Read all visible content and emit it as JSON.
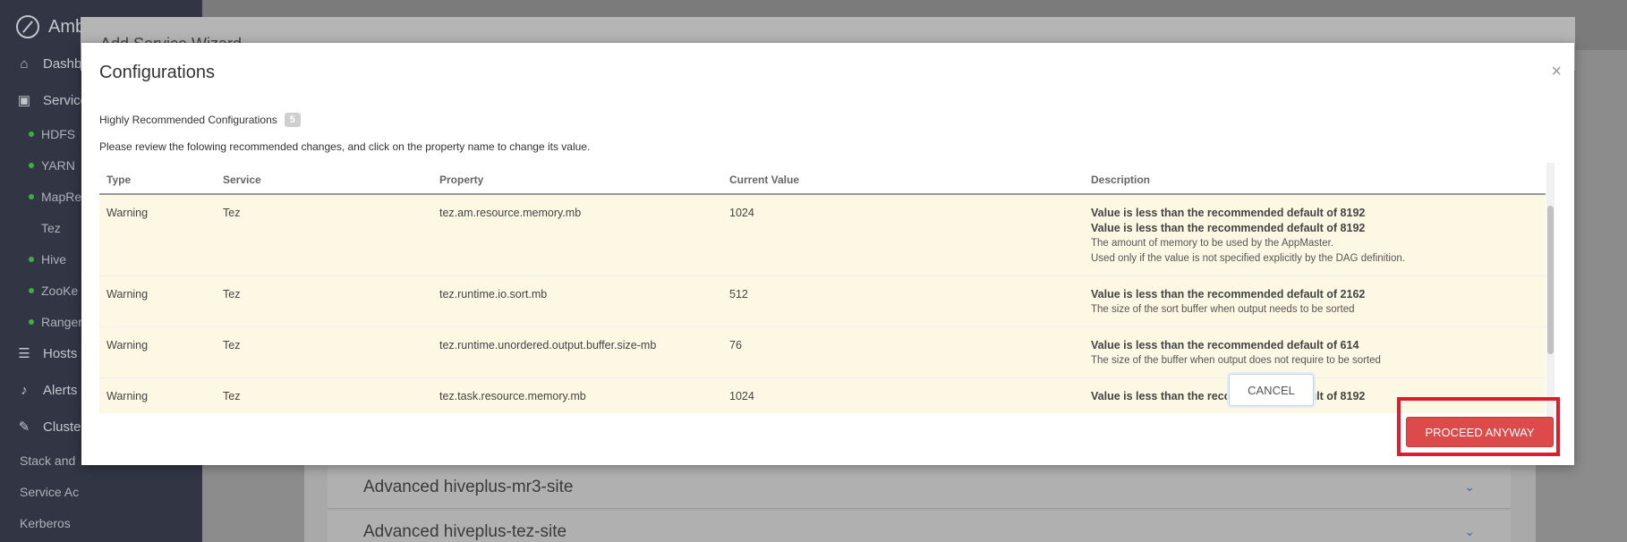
{
  "app": {
    "brand": "Amb",
    "wizard_title": "Add Service Wizard"
  },
  "sidebar": {
    "dashboard": "Dashbo",
    "services": "Service",
    "service_items": [
      "HDFS",
      "YARN",
      "MapRe"
    ],
    "tez": "Tez",
    "service_items_2": [
      "Hive",
      "ZooKe",
      "Ranger"
    ],
    "hosts": "Hosts",
    "alerts": "Alerts",
    "cluster": "Cluster",
    "cluster_items": [
      "Stack and",
      "Service Ac",
      "Kerberos"
    ]
  },
  "background_panels": [
    {
      "label": "Advanced hiveplus-mr3-site"
    },
    {
      "label": "Advanced hiveplus-tez-site"
    }
  ],
  "modal": {
    "title": "Configurations",
    "close_glyph": "×",
    "recommended_label": "Highly Recommended Configurations",
    "recommended_count": "5",
    "review_text": "Please review the folowing recommended changes, and click on the property name to change its value.",
    "columns": [
      "Type",
      "Service",
      "Property",
      "Current Value",
      "Description"
    ],
    "rows": [
      {
        "type": "Warning",
        "service": "Tez",
        "property": "tez.am.resource.memory.mb",
        "value": "1024",
        "desc_strong": [
          "Value is less than the recommended default of 8192",
          "Value is less than the recommended default of 8192"
        ],
        "desc_small": [
          "The amount of memory to be used by the AppMaster.",
          "Used only if the value is not specified explicitly by the DAG definition."
        ]
      },
      {
        "type": "Warning",
        "service": "Tez",
        "property": "tez.runtime.io.sort.mb",
        "value": "512",
        "desc_strong": [
          "Value is less than the recommended default of 2162"
        ],
        "desc_small": [
          "The size of the sort buffer when output needs to be sorted"
        ]
      },
      {
        "type": "Warning",
        "service": "Tez",
        "property": "tez.runtime.unordered.output.buffer.size-mb",
        "value": "76",
        "desc_strong": [
          "Value is less than the recommended default of 614"
        ],
        "desc_small": [
          "The size of the buffer when output does not require to be sorted"
        ]
      },
      {
        "type": "Warning",
        "service": "Tez",
        "property": "tez.task.resource.memory.mb",
        "value": "1024",
        "desc_strong": [
          "Value is less than the recommended default of 8192"
        ],
        "desc_small": []
      }
    ],
    "cancel_label": "CANCEL",
    "proceed_label": "PROCEED ANYWAY"
  },
  "colors": {
    "sidebar_bg": "#323544",
    "warning_row_bg": "#fcf8e3",
    "proceed_bg": "#dc4a4a",
    "highlight_border": "#e21a2b"
  }
}
